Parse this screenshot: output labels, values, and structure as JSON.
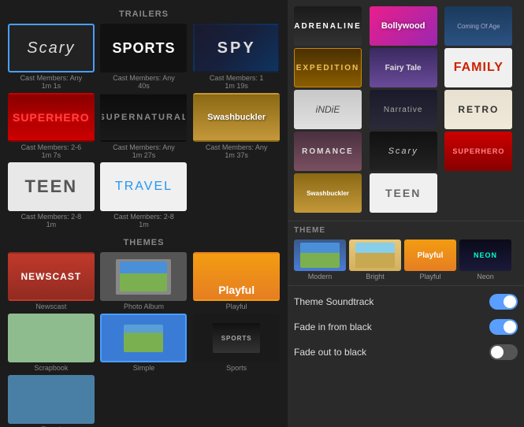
{
  "left": {
    "trailers_label": "TRAILERS",
    "themes_label": "THEMES",
    "trailers": [
      {
        "id": "scary",
        "label": "Scary",
        "meta": "Cast Members: Any\n1m 1s",
        "selected": true
      },
      {
        "id": "sports",
        "label": "Sports",
        "meta": "Cast Members: Any\n40s",
        "selected": false
      },
      {
        "id": "spy",
        "label": "SPY",
        "meta": "Cast Members: 1\n1m 19s",
        "selected": false
      },
      {
        "id": "superhero",
        "label": "SUPERHERO",
        "meta": "Cast Members: 2-6\n1m 7s",
        "selected": false
      },
      {
        "id": "supernatural",
        "label": "SUPERNATURAL",
        "meta": "Cast Members: Any\n1m 27s",
        "selected": false
      },
      {
        "id": "swashbuckler",
        "label": "Swashbuckler",
        "meta": "Cast Members: Any\n1m 37s",
        "selected": false
      },
      {
        "id": "teen",
        "label": "Teen",
        "meta": "Cast Members: 2-8\n1m",
        "selected": false
      },
      {
        "id": "travel",
        "label": "Travel",
        "meta": "Cast Members: 2-8\n1m",
        "selected": false
      }
    ],
    "themes": [
      {
        "id": "newscast",
        "label": "Newscast",
        "selected": false
      },
      {
        "id": "photo-album",
        "label": "Photo Album",
        "selected": false
      },
      {
        "id": "playful",
        "label": "Playful",
        "selected": false
      },
      {
        "id": "scrapbook",
        "label": "Scrapbook",
        "selected": false
      },
      {
        "id": "simple",
        "label": "Simple",
        "selected": true
      },
      {
        "id": "sports2",
        "label": "Sports",
        "selected": false
      },
      {
        "id": "travel2",
        "label": "Travel",
        "selected": false
      }
    ]
  },
  "right": {
    "trailers": [
      {
        "id": "adrenaline",
        "label": "Adrenaline"
      },
      {
        "id": "bollywood",
        "label": "Bollywood"
      },
      {
        "id": "coming-of-age",
        "label": "Coming Of Age"
      },
      {
        "id": "expedition",
        "label": "EXPEDITION"
      },
      {
        "id": "fairytale",
        "label": "Fairy Tale"
      },
      {
        "id": "family",
        "label": "FAMILY"
      },
      {
        "id": "indie",
        "label": "iNDiE"
      },
      {
        "id": "narrative",
        "label": "Narrative"
      },
      {
        "id": "retro",
        "label": "RETRO"
      },
      {
        "id": "romance",
        "label": "ROMANCE"
      },
      {
        "id": "scary",
        "label": "Scary"
      },
      {
        "id": "superhero",
        "label": "SUPERHERO"
      },
      {
        "id": "swashbuckler",
        "label": "Swashbuckler"
      },
      {
        "id": "teen",
        "label": "TEEN"
      }
    ],
    "theme_label": "THEME",
    "themes": [
      {
        "id": "modern",
        "label": "Modern"
      },
      {
        "id": "bright",
        "label": "Bright"
      },
      {
        "id": "playful",
        "label": "Playful"
      },
      {
        "id": "neon",
        "label": "Neon"
      }
    ],
    "settings": [
      {
        "id": "theme-soundtrack",
        "label": "Theme Soundtrack",
        "on": true
      },
      {
        "id": "fade-in",
        "label": "Fade in from black",
        "on": true
      },
      {
        "id": "fade-out",
        "label": "Fade out to black",
        "on": false
      }
    ]
  }
}
